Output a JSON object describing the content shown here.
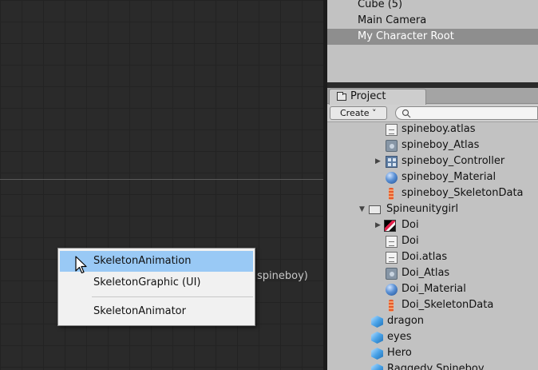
{
  "scene": {
    "ghost_label": "spineboy)"
  },
  "hierarchy": {
    "items": [
      {
        "label": "Cube (5)"
      },
      {
        "label": "Main Camera"
      },
      {
        "label": "My Character Root",
        "selected": true
      }
    ]
  },
  "project": {
    "tab_label": "Project",
    "create_label": "Create ˅",
    "search_placeholder": "",
    "rows": [
      {
        "label": "spineboy.atlas",
        "icon": "text-file-icon"
      },
      {
        "label": "spineboy_Atlas",
        "icon": "atlas-asset-icon"
      },
      {
        "label": "spineboy_Controller",
        "icon": "animator-controller-icon"
      },
      {
        "label": "spineboy_Material",
        "icon": "material-sphere-icon"
      },
      {
        "label": "spineboy_SkeletonData",
        "icon": "skeleton-data-icon"
      },
      {
        "label": "Spineunitygirl",
        "icon": "folder-icon"
      },
      {
        "label": "Doi",
        "icon": "image-texture-icon"
      },
      {
        "label": "Doi",
        "icon": "text-file-icon"
      },
      {
        "label": "Doi.atlas",
        "icon": "text-file-icon"
      },
      {
        "label": "Doi_Atlas",
        "icon": "atlas-asset-icon"
      },
      {
        "label": "Doi_Material",
        "icon": "material-sphere-icon"
      },
      {
        "label": "Doi_SkeletonData",
        "icon": "skeleton-data-icon"
      },
      {
        "label": "dragon",
        "icon": "prefab-cube-icon"
      },
      {
        "label": "eyes",
        "icon": "prefab-cube-icon"
      },
      {
        "label": "Hero",
        "icon": "prefab-cube-icon"
      },
      {
        "label": "Raggedy Spineboy",
        "icon": "prefab-cube-icon"
      }
    ]
  },
  "context_menu": {
    "items": [
      {
        "label": "SkeletonAnimation",
        "highlighted": true
      },
      {
        "label": "SkeletonGraphic (UI)"
      },
      {
        "label": "SkeletonAnimator"
      }
    ]
  },
  "colors": {
    "scene_bg": "#2a2a2a",
    "panel_bg": "#c2c2c2",
    "selection": "#8e8e8e",
    "menu_highlight": "#99c9f5"
  }
}
